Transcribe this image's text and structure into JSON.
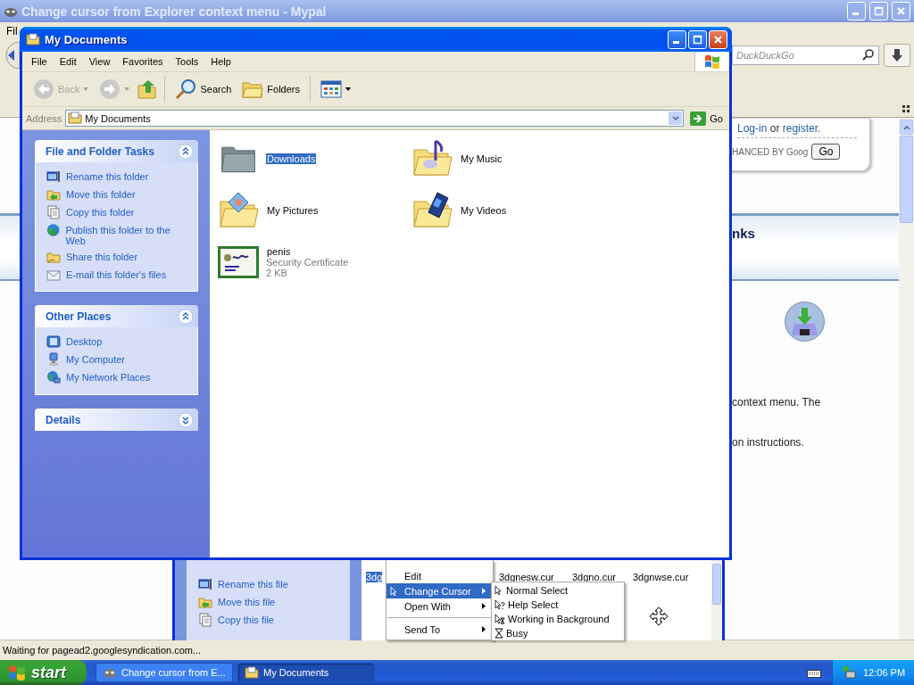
{
  "browser": {
    "title": "Change cursor from Explorer context menu - Mypal",
    "menu": [
      "Fil"
    ],
    "search": {
      "placeholder": "DuckDuckGo"
    },
    "login": {
      "login_link": "Log-in",
      "middle": "or",
      "register_link": "register."
    },
    "search_banner": {
      "text": "HANCED BY Goog",
      "button": "Go"
    },
    "heading": "nks",
    "paragraphs": [
      "context menu.  The",
      "on instructions."
    ],
    "status_bar": "Waiting for pagead2.googlesyndication.com..."
  },
  "explorer": {
    "title": "My Documents",
    "menu": [
      "File",
      "Edit",
      "View",
      "Favorites",
      "Tools",
      "Help"
    ],
    "toolbar": [
      {
        "label": "Back",
        "disabled": true
      },
      {
        "label": "Search",
        "disabled": false
      },
      {
        "label": "Folders",
        "disabled": false
      }
    ],
    "address": {
      "label": "Address",
      "value": "My Documents",
      "go": "Go"
    },
    "panels": [
      {
        "title": "File and Folder Tasks",
        "expanded": true,
        "items": [
          {
            "label": "Rename this folder",
            "kind": "rename"
          },
          {
            "label": "Move this folder",
            "kind": "move"
          },
          {
            "label": "Copy this folder",
            "kind": "copy"
          },
          {
            "label": "Publish this folder to the Web",
            "kind": "publish"
          },
          {
            "label": "Share this folder",
            "kind": "share"
          },
          {
            "label": "E-mail this folder's files",
            "kind": "email"
          }
        ]
      },
      {
        "title": "Other Places",
        "expanded": true,
        "items": [
          {
            "label": "Desktop",
            "kind": "desktop"
          },
          {
            "label": "My Computer",
            "kind": "computer"
          },
          {
            "label": "My Network Places",
            "kind": "network"
          }
        ]
      },
      {
        "title": "Details",
        "expanded": false
      }
    ],
    "files": [
      {
        "name": "Downloads",
        "kind": "gray-folder",
        "selected": true
      },
      {
        "name": "My Music",
        "kind": "music-folder",
        "selected": false
      },
      {
        "name": "My Pictures",
        "kind": "pictures-folder",
        "selected": false
      },
      {
        "name": "My Videos",
        "kind": "videos-folder",
        "selected": false
      },
      {
        "name": "penis",
        "kind": "certificate",
        "selected": false,
        "details": [
          "Security Certificate",
          "2 KB"
        ]
      }
    ]
  },
  "background_window": {
    "tasks": [
      {
        "label": "Rename this file",
        "kind": "rename"
      },
      {
        "label": "Move this file",
        "kind": "move"
      },
      {
        "label": "Copy this file",
        "kind": "copy"
      }
    ],
    "files": [
      {
        "name": "3dg",
        "selected": true
      },
      {
        "name": "3dgnesw.cur",
        "selected": false
      },
      {
        "name": "3dgno.cur",
        "selected": false
      },
      {
        "name": "3dgnwse.cur",
        "selected": false
      }
    ]
  },
  "context_menu": {
    "items": [
      {
        "kind": "item",
        "label": "Edit",
        "selected": false,
        "submenu": false
      },
      {
        "kind": "item",
        "label": "Change Cursor",
        "selected": true,
        "submenu": true
      },
      {
        "kind": "item",
        "label": "Open With",
        "selected": false,
        "submenu": true
      },
      {
        "kind": "separator"
      },
      {
        "kind": "item",
        "label": "Send To",
        "selected": false,
        "submenu": true
      }
    ]
  },
  "submenu": {
    "items": [
      {
        "label": "Normal Select",
        "kind": "arrow"
      },
      {
        "label": "Help Select",
        "kind": "help"
      },
      {
        "label": "Working in Background",
        "kind": "working"
      },
      {
        "label": "Busy",
        "kind": "busy"
      }
    ]
  },
  "taskbar": {
    "start": "start",
    "tasks": [
      {
        "label": "Change cursor from E...",
        "selected": false
      },
      {
        "label": "My Documents",
        "selected": true
      }
    ],
    "clock": "12:06 PM"
  }
}
